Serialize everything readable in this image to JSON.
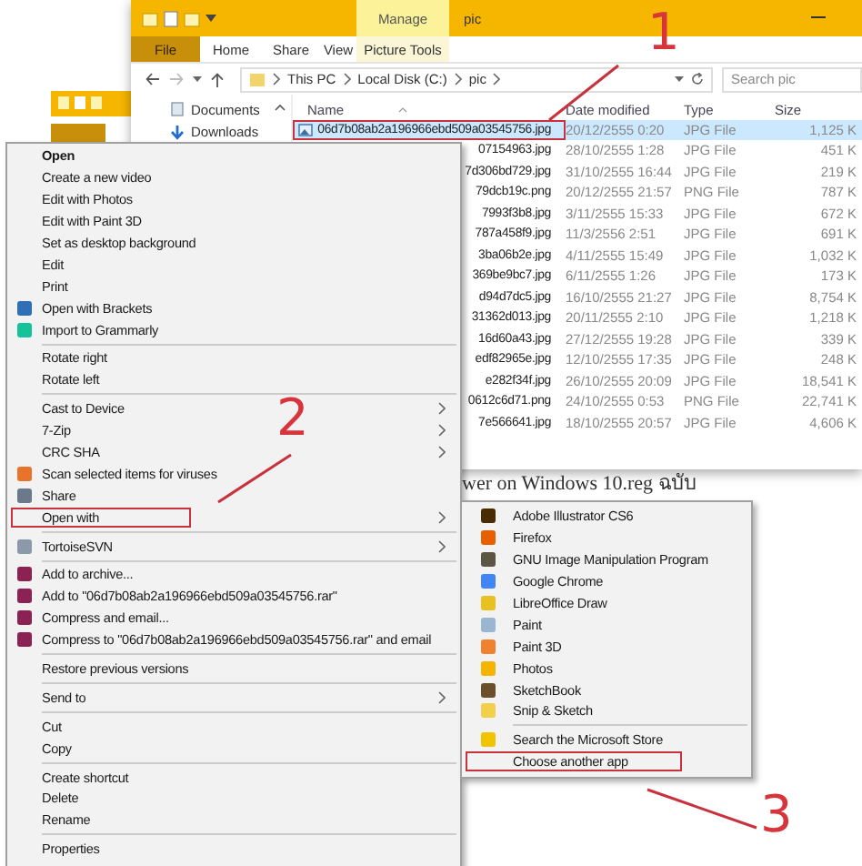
{
  "page_text": "wer on Windows 10.reg ฉบับ",
  "explorer": {
    "context_tab": "Manage",
    "title": "pic",
    "tabs": [
      {
        "label": "File",
        "kind": "file"
      },
      {
        "label": "Home",
        "kind": "tab"
      },
      {
        "label": "Share",
        "kind": "tab"
      },
      {
        "label": "View",
        "kind": "tab"
      },
      {
        "label": "Picture Tools",
        "kind": "context"
      }
    ],
    "path": [
      "This PC",
      "Local Disk (C:)",
      "pic"
    ],
    "search_placeholder": "Search pic",
    "nav": [
      "Documents",
      "Downloads"
    ],
    "columns": [
      "Name",
      "Date modified",
      "Type",
      "Size"
    ],
    "rows": [
      {
        "name": "06d7b08ab2a196966ebd509a03545756.jpg",
        "date": "20/12/2555 0:20",
        "type": "JPG File",
        "size": "1,125 K",
        "selected": true,
        "highlighted": true
      },
      {
        "name": "07154963.jpg",
        "date": "28/10/2555 1:28",
        "type": "JPG File",
        "size": "451 K",
        "selected": false,
        "highlighted": false
      },
      {
        "name": "7d306bd729.jpg",
        "date": "31/10/2555 16:44",
        "type": "JPG File",
        "size": "219 K",
        "selected": false,
        "highlighted": false
      },
      {
        "name": "79dcb19c.png",
        "date": "20/12/2555 21:57",
        "type": "PNG File",
        "size": "787 K",
        "selected": false,
        "highlighted": false
      },
      {
        "name": "7993f3b8.jpg",
        "date": "3/11/2555 15:33",
        "type": "JPG File",
        "size": "672 K",
        "selected": false,
        "highlighted": false
      },
      {
        "name": "787a458f9.jpg",
        "date": "11/3/2556 2:51",
        "type": "JPG File",
        "size": "691 K",
        "selected": false,
        "highlighted": false
      },
      {
        "name": "3ba06b2e.jpg",
        "date": "4/11/2555 15:49",
        "type": "JPG File",
        "size": "1,032 K",
        "selected": false,
        "highlighted": false
      },
      {
        "name": "369be9bc7.jpg",
        "date": "6/11/2555 1:26",
        "type": "JPG File",
        "size": "173 K",
        "selected": false,
        "highlighted": false
      },
      {
        "name": "d94d7dc5.jpg",
        "date": "16/10/2555 21:27",
        "type": "JPG File",
        "size": "8,754 K",
        "selected": false,
        "highlighted": false
      },
      {
        "name": "31362d013.jpg",
        "date": "20/11/2555 2:10",
        "type": "JPG File",
        "size": "1,218 K",
        "selected": false,
        "highlighted": false
      },
      {
        "name": "16d60a43.jpg",
        "date": "27/12/2555 19:28",
        "type": "JPG File",
        "size": "339 K",
        "selected": false,
        "highlighted": false
      },
      {
        "name": "edf82965e.jpg",
        "date": "12/10/2555 17:35",
        "type": "JPG File",
        "size": "248 K",
        "selected": false,
        "highlighted": false
      },
      {
        "name": "e282f34f.jpg",
        "date": "26/10/2555 20:09",
        "type": "JPG File",
        "size": "18,541 K",
        "selected": false,
        "highlighted": false
      },
      {
        "name": "0612c6d71.png",
        "date": "24/10/2555 0:53",
        "type": "PNG File",
        "size": "22,741 K",
        "selected": false,
        "highlighted": false
      },
      {
        "name": "7e566641.jpg",
        "date": "18/10/2555 20:57",
        "type": "JPG File",
        "size": "4,606 K",
        "selected": false,
        "highlighted": false
      }
    ]
  },
  "context_menu": [
    {
      "kind": "item",
      "label": "Open",
      "bold": true,
      "submenu": false,
      "highlighted": false
    },
    {
      "kind": "item",
      "label": "Create a new video",
      "bold": false,
      "submenu": false,
      "highlighted": false
    },
    {
      "kind": "item",
      "label": "Edit with Photos",
      "bold": false,
      "submenu": false,
      "highlighted": false
    },
    {
      "kind": "item",
      "label": "Edit with Paint 3D",
      "bold": false,
      "submenu": false,
      "highlighted": false
    },
    {
      "kind": "item",
      "label": "Set as desktop background",
      "bold": false,
      "submenu": false,
      "highlighted": false
    },
    {
      "kind": "item",
      "label": "Edit",
      "bold": false,
      "submenu": false,
      "highlighted": false
    },
    {
      "kind": "item",
      "label": "Print",
      "bold": false,
      "submenu": false,
      "highlighted": false
    },
    {
      "kind": "item",
      "label": "Open with Brackets",
      "bold": false,
      "submenu": false,
      "highlighted": false,
      "color": "#2f6fb7"
    },
    {
      "kind": "item",
      "label": "Import to Grammarly",
      "bold": false,
      "submenu": false,
      "highlighted": false,
      "color": "#15c39a"
    },
    {
      "kind": "separator"
    },
    {
      "kind": "item",
      "label": "Rotate right",
      "bold": false,
      "submenu": false,
      "highlighted": false
    },
    {
      "kind": "item",
      "label": "Rotate left",
      "bold": false,
      "submenu": false,
      "highlighted": false
    },
    {
      "kind": "separator"
    },
    {
      "kind": "item",
      "label": "Cast to Device",
      "bold": false,
      "submenu": true,
      "highlighted": false
    },
    {
      "kind": "item",
      "label": "7-Zip",
      "bold": false,
      "submenu": true,
      "highlighted": false
    },
    {
      "kind": "item",
      "label": "CRC SHA",
      "bold": false,
      "submenu": true,
      "highlighted": false
    },
    {
      "kind": "item",
      "label": "Scan selected items for viruses",
      "bold": false,
      "submenu": false,
      "highlighted": false,
      "color": "#e8742c"
    },
    {
      "kind": "item",
      "label": "Share",
      "bold": false,
      "submenu": false,
      "highlighted": false,
      "color": "#6a7a8a"
    },
    {
      "kind": "item",
      "label": "Open with",
      "bold": false,
      "submenu": true,
      "highlighted": true
    },
    {
      "kind": "separator"
    },
    {
      "kind": "item",
      "label": "TortoiseSVN",
      "bold": false,
      "submenu": true,
      "highlighted": false,
      "color": "#8a9aaa"
    },
    {
      "kind": "separator"
    },
    {
      "kind": "item",
      "label": "Add to archive...",
      "bold": false,
      "submenu": false,
      "highlighted": false,
      "color": "#8b2252"
    },
    {
      "kind": "item",
      "label": "Add to \"06d7b08ab2a196966ebd509a03545756.rar\"",
      "bold": false,
      "submenu": false,
      "highlighted": false,
      "color": "#8b2253"
    },
    {
      "kind": "item",
      "label": "Compress and email...",
      "bold": false,
      "submenu": false,
      "highlighted": false,
      "color": "#8b2254"
    },
    {
      "kind": "item",
      "label": "Compress to \"06d7b08ab2a196966ebd509a03545756.rar\" and email",
      "bold": false,
      "submenu": false,
      "highlighted": false,
      "color": "#8b2255"
    },
    {
      "kind": "separator"
    },
    {
      "kind": "item",
      "label": "Restore previous versions",
      "bold": false,
      "submenu": false,
      "highlighted": false
    },
    {
      "kind": "separator"
    },
    {
      "kind": "item",
      "label": "Send to",
      "bold": false,
      "submenu": true,
      "highlighted": false
    },
    {
      "kind": "separator"
    },
    {
      "kind": "item",
      "label": "Cut",
      "bold": false,
      "submenu": false,
      "highlighted": false
    },
    {
      "kind": "item",
      "label": "Copy",
      "bold": false,
      "submenu": false,
      "highlighted": false
    },
    {
      "kind": "separator"
    },
    {
      "kind": "item",
      "label": "Create shortcut",
      "bold": false,
      "submenu": false,
      "highlighted": false
    },
    {
      "kind": "item",
      "label": "Delete",
      "bold": false,
      "submenu": false,
      "highlighted": false
    },
    {
      "kind": "item",
      "label": "Rename",
      "bold": false,
      "submenu": false,
      "highlighted": false
    },
    {
      "kind": "separator"
    },
    {
      "kind": "item",
      "label": "Properties",
      "bold": false,
      "submenu": false,
      "highlighted": false
    }
  ],
  "open_with_menu": [
    {
      "kind": "item",
      "label": "Adobe Illustrator CS6",
      "highlighted": false,
      "color": "#4a2a00"
    },
    {
      "kind": "item",
      "label": "Firefox",
      "highlighted": false,
      "color": "#e66000"
    },
    {
      "kind": "item",
      "label": "GNU Image Manipulation Program",
      "highlighted": false,
      "color": "#5c5543"
    },
    {
      "kind": "item",
      "label": "Google Chrome",
      "highlighted": false,
      "color": "#4285f4"
    },
    {
      "kind": "item",
      "label": "LibreOffice Draw",
      "highlighted": false,
      "color": "#e8c020"
    },
    {
      "kind": "item",
      "label": "Paint",
      "highlighted": false,
      "color": "#9ab6d0"
    },
    {
      "kind": "item",
      "label": "Paint 3D",
      "highlighted": false,
      "color": "#f0812e"
    },
    {
      "kind": "item",
      "label": "Photos",
      "highlighted": false,
      "color": "#f4b400"
    },
    {
      "kind": "item",
      "label": "SketchBook",
      "highlighted": false,
      "color": "#6b4f2a"
    },
    {
      "kind": "item",
      "label": "Snip & Sketch",
      "highlighted": false,
      "color": "#f2d04c"
    },
    {
      "kind": "separator"
    },
    {
      "kind": "item",
      "label": "Search the Microsoft Store",
      "highlighted": false,
      "color": "#f2c300"
    },
    {
      "kind": "item",
      "label": "Choose another app",
      "highlighted": true
    }
  ],
  "annotations": [
    {
      "label": "1"
    },
    {
      "label": "2"
    },
    {
      "label": "3"
    }
  ]
}
